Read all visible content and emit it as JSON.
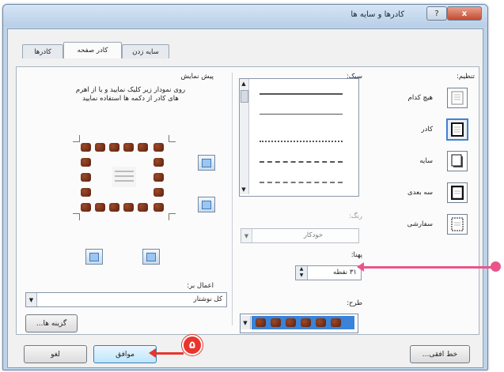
{
  "window": {
    "title": "کادرها و سایه ها",
    "help_glyph": "?",
    "close_glyph": "x"
  },
  "tabs": [
    {
      "label": "کادرها"
    },
    {
      "label": "کادر صفحه"
    },
    {
      "label": "سایه زدن"
    }
  ],
  "settings": {
    "heading": "تنظیم:",
    "items": [
      {
        "label": "هیچ کدام"
      },
      {
        "label": "کادر"
      },
      {
        "label": "سایه"
      },
      {
        "label": "سه بعدی"
      },
      {
        "label": "سفارشی"
      }
    ]
  },
  "style": {
    "heading": "سبک:"
  },
  "color": {
    "heading": "رنگ:",
    "value": "خودکار"
  },
  "width": {
    "heading": "پهنا:",
    "value": "۳۱ نقطه"
  },
  "art": {
    "heading": "طرح:"
  },
  "preview": {
    "heading": "پیش نمایش",
    "instructions": "روی نمودار زیر کلیک نمایید و یا از اهرم های کادر از دکمه ها استفاده نمایید"
  },
  "apply_to": {
    "heading": "اعمال بر:",
    "value": "کل نوشتار"
  },
  "buttons": {
    "options": "گزینه ها...",
    "horizontal_line": "خط افقی...",
    "ok": "موافق",
    "cancel": "لغو"
  },
  "annotation": {
    "step_number": "۵"
  },
  "colors": {
    "callout": "#e9558b",
    "badge": "#e8352d",
    "selection": "#3a83d8"
  }
}
